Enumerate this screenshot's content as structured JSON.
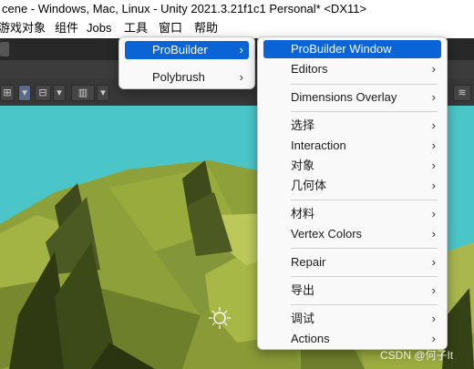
{
  "window": {
    "title": "cene - Windows, Mac, Linux - Unity 2021.3.21f1c1 Personal* <DX11>"
  },
  "menubar": {
    "items": [
      "游戏对象",
      "组件",
      "Jobs",
      "工具",
      "窗口",
      "帮助"
    ]
  },
  "tools_menu": {
    "items": [
      {
        "label": "ProBuilder",
        "selected": true,
        "has_submenu": true
      },
      {
        "label": "Polybrush",
        "selected": false,
        "has_submenu": true
      }
    ]
  },
  "probuilder_menu": {
    "items": [
      {
        "label": "ProBuilder Window",
        "selected": true,
        "has_submenu": false
      },
      {
        "label": "Editors",
        "has_submenu": true
      },
      {
        "label": "Dimensions Overlay",
        "has_submenu": true
      },
      {
        "label": "选择",
        "has_submenu": true
      },
      {
        "label": "Interaction",
        "has_submenu": true
      },
      {
        "label": "对象",
        "has_submenu": true
      },
      {
        "label": "几何体",
        "has_submenu": true
      },
      {
        "label": "材料",
        "has_submenu": true
      },
      {
        "label": "Vertex Colors",
        "has_submenu": true
      },
      {
        "label": "Repair",
        "has_submenu": true
      },
      {
        "label": "导出",
        "has_submenu": true
      },
      {
        "label": "调试",
        "has_submenu": true
      },
      {
        "label": "Actions",
        "has_submenu": true
      }
    ]
  },
  "arrow_glyph": "›",
  "watermark": "CSDN @何子It",
  "colors": {
    "selection": "#0a64d6",
    "menu_bg": "#f9f9f9",
    "sky": "#4bc6c8",
    "grass": "#8ea03a"
  }
}
